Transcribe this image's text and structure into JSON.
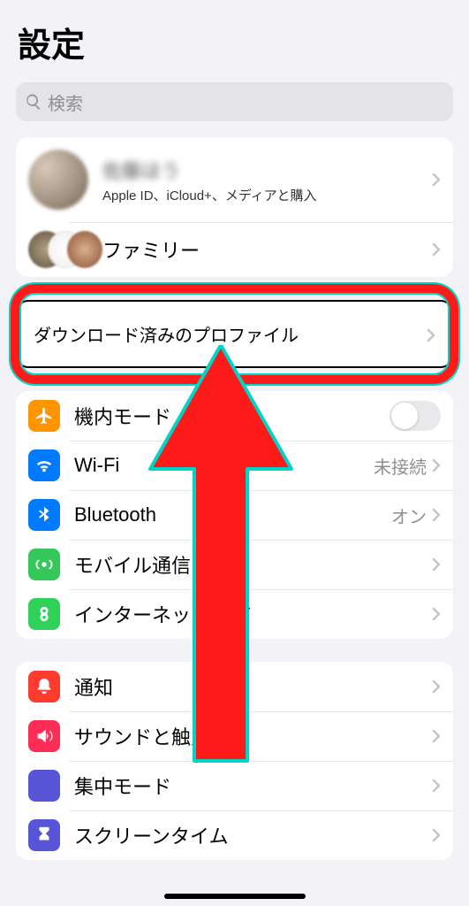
{
  "header": {
    "title": "設定"
  },
  "search": {
    "placeholder": "検索"
  },
  "account": {
    "name": "佐藤ほう",
    "subtitle": "Apple ID、iCloud+、メディアと購入",
    "family_label": "ファミリー"
  },
  "profile": {
    "label": "ダウンロード済みのプロファイル"
  },
  "network": {
    "airplane": "機内モード",
    "wifi": "Wi-Fi",
    "wifi_value": "未接続",
    "bluetooth": "Bluetooth",
    "bluetooth_value": "オン",
    "cellular": "モバイル通信",
    "hotspot_pre": "インターネット",
    "hotspot_post": "有"
  },
  "general": {
    "notifications": "通知",
    "sounds": "サウンドと触覚",
    "focus": "集中モード",
    "screentime": "スクリーンタイム"
  }
}
